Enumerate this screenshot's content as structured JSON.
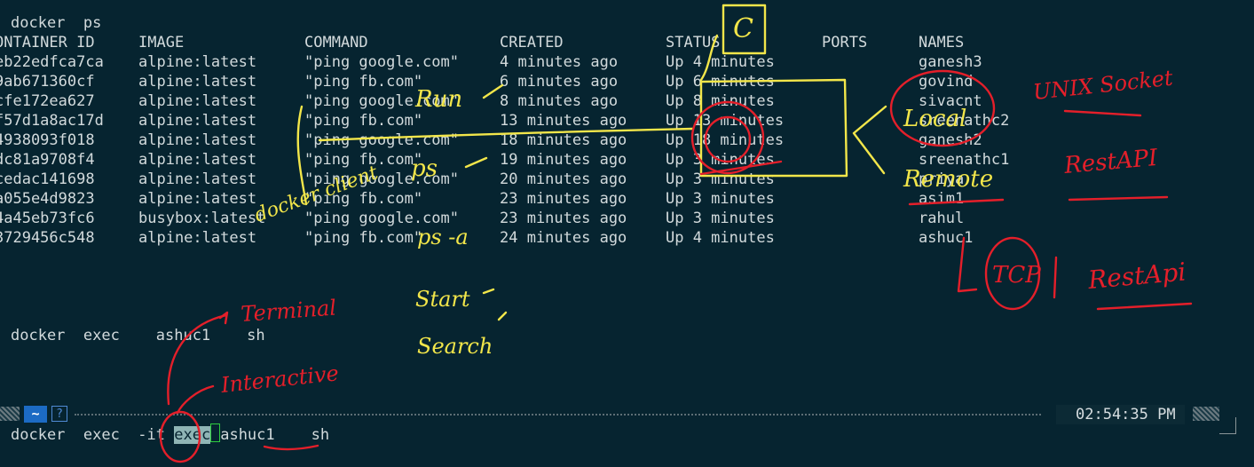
{
  "terminal": {
    "ps_command": "docker  ps",
    "headers": {
      "container_id": "ONTAINER ID",
      "image": "IMAGE",
      "command": "COMMAND",
      "created": "CREATED",
      "status": "STATUS",
      "ports": "PORTS",
      "names": "NAMES"
    },
    "rows": [
      {
        "id": "eb22edfca7ca",
        "image": "alpine:latest",
        "command": "\"ping google.com\"",
        "created": "4 minutes ago",
        "status": "Up 4 minutes",
        "name": "ganesh3"
      },
      {
        "id": "9ab671360cf",
        "image": "alpine:latest",
        "command": "\"ping fb.com\"",
        "created": "6 minutes ago",
        "status": "Up 6 minutes",
        "name": "govind"
      },
      {
        "id": "cfe172ea627",
        "image": "alpine:latest",
        "command": "\"ping google.com\"",
        "created": "8 minutes ago",
        "status": "Up 8 minutes",
        "name": "sivacnt"
      },
      {
        "id": "f57d1a8ac17d",
        "image": "alpine:latest",
        "command": "\"ping fb.com\"",
        "created": "13 minutes ago",
        "status": "Up 13 minutes",
        "name": "sreenathc2"
      },
      {
        "id": "4938093f018",
        "image": "alpine:latest",
        "command": "\"ping google.com\"",
        "created": "18 minutes ago",
        "status": "Up 18 minutes",
        "name": "ganesh2"
      },
      {
        "id": "dc81a9708f4",
        "image": "alpine:latest",
        "command": "\"ping fb.com\"",
        "created": "19 minutes ago",
        "status": "Up 3 minutes",
        "name": "sreenathc1"
      },
      {
        "id": "cedac141698",
        "image": "alpine:latest",
        "command": "\"ping google.com\"",
        "created": "20 minutes ago",
        "status": "Up 3 minutes",
        "name": "priya"
      },
      {
        "id": "a055e4d9823",
        "image": "alpine:latest",
        "command": "\"ping fb.com\"",
        "created": "23 minutes ago",
        "status": "Up 3 minutes",
        "name": "asim1"
      },
      {
        "id": "4a45eb73fc6",
        "image": "busybox:latest",
        "command": "\"ping google.com\"",
        "created": "23 minutes ago",
        "status": "Up 3 minutes",
        "name": "rahul"
      },
      {
        "id": "3729456c548",
        "image": "alpine:latest",
        "command": "\"ping fb.com\"",
        "created": "24 minutes ago",
        "status": "Up 4 minutes",
        "name": "ashuc1"
      }
    ],
    "exec_line": "docker  exec    ashuc1    sh",
    "prompt": {
      "tilde": "~",
      "help": "?",
      "clock": "02:54:35 PM"
    },
    "input": {
      "part1": "docker  exec  ",
      "flag": "-it",
      "highlight": "exec",
      "name": "ashuc1",
      "tail": "    sh"
    }
  },
  "annotations": {
    "yellow": [
      "C",
      "Run",
      "ps",
      "ps -a",
      "docker client",
      "Start",
      "Search",
      "Local",
      "Remote"
    ],
    "red": [
      "UNIX Socket",
      "RestAPI",
      "TCP",
      "RestApi",
      "Terminal",
      "Interactive"
    ]
  },
  "colors": {
    "background": "#062430",
    "text": "#d2dadc",
    "annotation_yellow": "#f2e64a",
    "annotation_red": "#e41f2a",
    "prompt_accent": "#1c6bc4"
  }
}
